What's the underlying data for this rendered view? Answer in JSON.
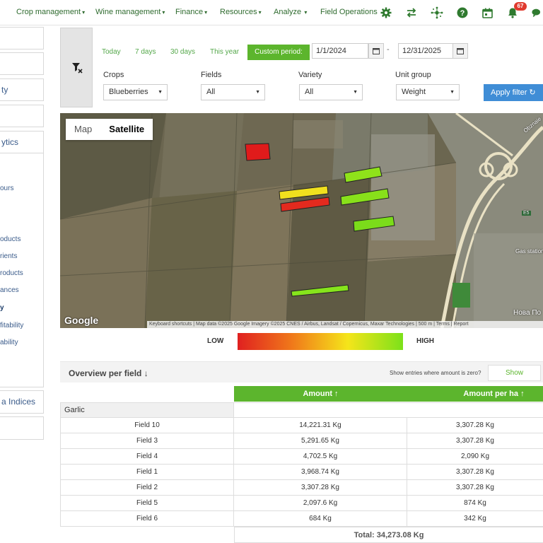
{
  "nav": {
    "items": [
      "Crop management",
      "Wine management",
      "Finance",
      "Resources",
      "Analyze",
      "Field Operations"
    ],
    "notification_count": "67"
  },
  "sidebar": {
    "boxes": [
      "",
      "",
      "ty",
      "",
      "ytics",
      "a Indices",
      ""
    ],
    "links": [
      "ours",
      "oducts",
      "rients",
      "roducts",
      "ances",
      "y",
      "fitability",
      "ability"
    ]
  },
  "filters": {
    "periods": [
      "Today",
      "7 days",
      "30 days",
      "This year"
    ],
    "custom_period": "Custom period:",
    "date_from": "1/1/2024",
    "date_to": "12/31/2025",
    "date_sep": "-",
    "crops_label": "Crops",
    "crops_value": "Blueberries",
    "fields_label": "Fields",
    "fields_value": "All",
    "variety_label": "Variety",
    "variety_value": "All",
    "unit_label": "Unit group",
    "unit_value": "Weight",
    "apply": "Apply filter"
  },
  "map": {
    "type_map": "Map",
    "type_satellite": "Satellite",
    "google": "Google",
    "footer": "Keyboard shortcuts | Map data ©2025 Google Imagery ©2025 CNES / Airbus, Landsat / Copernicus, Maxar Technologies | 500 m | Terms | Report",
    "label_road": "Obznaie",
    "label_gas": "Gas station",
    "label_town": "Нова По",
    "label_e5": "E5",
    "field_colors": [
      "#e01b1b",
      "#f0e01e",
      "#e32a1e",
      "#8fe21a",
      "#88e01a",
      "#7bdc1a",
      "#86e41c"
    ]
  },
  "legend": {
    "low": "LOW",
    "high": "HIGH"
  },
  "overview": {
    "title": "Overview per field",
    "title_icon": "↓",
    "zero_label": "Show entries where amount is zero?",
    "show": "Show"
  },
  "table": {
    "col_amount": "Amount ↑",
    "col_per_ha": "Amount per ha ↑",
    "group": "Garlic",
    "rows": [
      {
        "field": "Field 10",
        "amount": "14,221.31 Kg",
        "per_ha": "3,307.28 Kg"
      },
      {
        "field": "Field 3",
        "amount": "5,291.65 Kg",
        "per_ha": "3,307.28 Kg"
      },
      {
        "field": "Field 4",
        "amount": "4,702.5 Kg",
        "per_ha": "2,090 Kg"
      },
      {
        "field": "Field 1",
        "amount": "3,968.74 Kg",
        "per_ha": "3,307.28 Kg"
      },
      {
        "field": "Field 2",
        "amount": "3,307.28 Kg",
        "per_ha": "3,307.28 Kg"
      },
      {
        "field": "Field 5",
        "amount": "2,097.6 Kg",
        "per_ha": "874 Kg"
      },
      {
        "field": "Field 6",
        "amount": "684 Kg",
        "per_ha": "342 Kg"
      }
    ],
    "total": "Total: 34,273.08  Kg"
  },
  "colors": {
    "accent_green": "#5cb52d",
    "nav_green": "#2f6b2f",
    "button_blue": "#3f8dd6"
  }
}
